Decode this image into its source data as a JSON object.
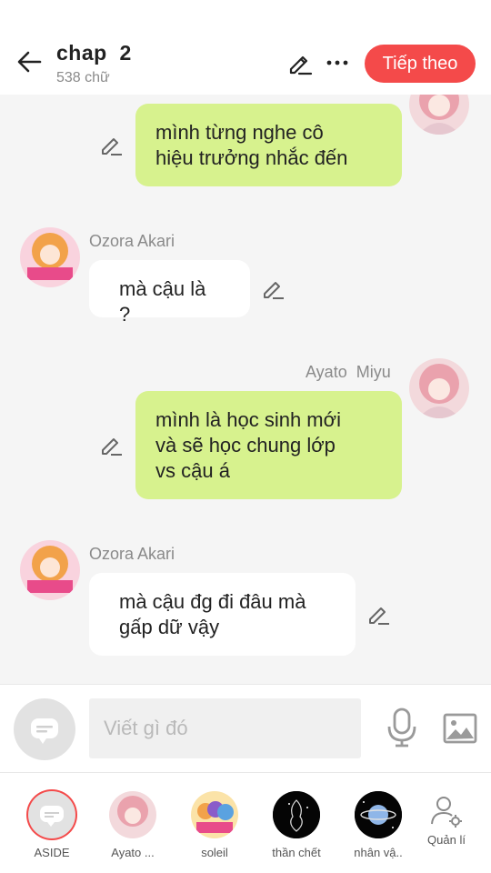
{
  "header": {
    "title": "chap  2",
    "subtitle": "538 chữ",
    "next_label": "Tiếp theo",
    "accent": "#f44a4a"
  },
  "messages": [
    {
      "side": "right",
      "text": "mình từng nghe cô\nhiệu trưởng nhắc đến"
    },
    {
      "side": "left",
      "sender": "Ozora Akari",
      "text": "mà cậu là ?"
    },
    {
      "side": "right",
      "sender": "Ayato  Miyu",
      "text": "mình là học sinh mới\nvà sẽ học chung lớp\nvs cậu á"
    },
    {
      "side": "left",
      "sender": "Ozora Akari",
      "text": "mà cậu đg đi đâu mà\ngấp dữ vậy"
    }
  ],
  "input": {
    "placeholder": "Viết gì đó",
    "bubble_color_right": "#d7f28e"
  },
  "characters": [
    {
      "label": "ASIDE",
      "icon": "aside-chat-icon"
    },
    {
      "label": "Ayato ..."
    },
    {
      "label": "soleil"
    },
    {
      "label": "thần chết"
    },
    {
      "label": "nhân vậ.."
    },
    {
      "label": "Quản lí",
      "icon": "user-settings-icon"
    }
  ]
}
